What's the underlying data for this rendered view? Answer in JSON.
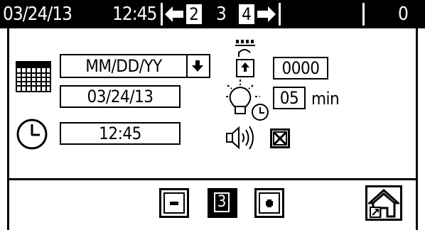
{
  "status_bar": {
    "date": "03/24/13",
    "time": "12:45",
    "screen_tabs": [
      "2",
      "3",
      "4"
    ],
    "count": "0"
  },
  "settings": {
    "date_format": "MM/DD/YY",
    "date_value": "03/24/13",
    "time_value": "12:45",
    "password": "0000",
    "backlight_timer": "05",
    "backlight_unit": "min",
    "sound_enabled": true
  },
  "footer": {
    "current_page": "3"
  }
}
